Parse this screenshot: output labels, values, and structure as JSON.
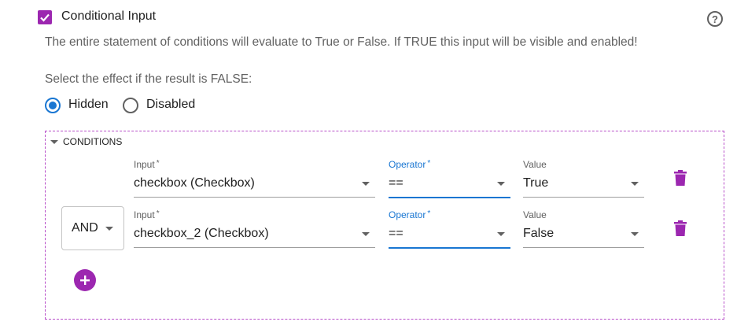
{
  "header": {
    "title": "Conditional Input",
    "checked": true,
    "help_symbol": "?",
    "description": "The entire statement of conditions will evaluate to True or False. If TRUE this input will be visible and enabled!"
  },
  "effect": {
    "label": "Select the effect if the result is FALSE:",
    "options": [
      {
        "label": "Hidden",
        "checked": true
      },
      {
        "label": "Disabled",
        "checked": false
      }
    ]
  },
  "conditions": {
    "section_label": "CONDITIONS",
    "rows": [
      {
        "input": {
          "label": "Input",
          "required": "*",
          "value": "checkbox (Checkbox)"
        },
        "operator": {
          "label": "Operator",
          "required": "*",
          "value": "=="
        },
        "value": {
          "label": "Value",
          "value": "True"
        }
      },
      {
        "connector": "AND",
        "input": {
          "label": "Input",
          "required": "*",
          "value": "checkbox_2 (Checkbox)"
        },
        "operator": {
          "label": "Operator",
          "required": "*",
          "value": "=="
        },
        "value": {
          "label": "Value",
          "value": "False"
        }
      }
    ]
  },
  "colors": {
    "accent": "#9c27b0",
    "primary": "#1976d2",
    "muted_text": "#616161"
  },
  "icons": [
    "check-icon",
    "help-icon",
    "chevron-down-icon",
    "trash-icon",
    "plus-icon"
  ]
}
